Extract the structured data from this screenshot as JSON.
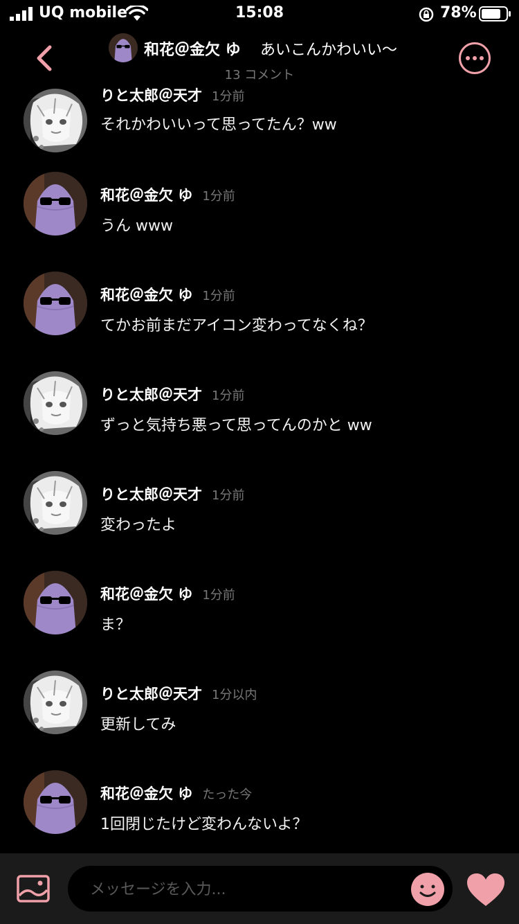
{
  "status_bar": {
    "carrier": "UQ mobile",
    "time": "15:08",
    "battery": "78%"
  },
  "header": {
    "user": "和花＠金欠 ゆ",
    "topic": "あいこんかわいい〜",
    "comment_count": "13 コメント"
  },
  "messages": [
    {
      "user": "りと太郎＠天才",
      "time": "1分前",
      "text": "それかわいいって思ってたん？ww",
      "avatar": "anime-girl"
    },
    {
      "user": "和花＠金欠 ゆ",
      "time": "1分前",
      "text": "うん www",
      "avatar": "purple-ghost"
    },
    {
      "user": "和花＠金欠 ゆ",
      "time": "1分前",
      "text": "てかお前まだアイコン変わってなくね？",
      "avatar": "purple-ghost"
    },
    {
      "user": "りと太郎＠天才",
      "time": "1分前",
      "text": "ずっと気持ち悪って思ってんのかと ww",
      "avatar": "anime-girl"
    },
    {
      "user": "りと太郎＠天才",
      "time": "1分前",
      "text": "変わったよ",
      "avatar": "anime-girl"
    },
    {
      "user": "和花＠金欠 ゆ",
      "time": "1分前",
      "text": "ま？",
      "avatar": "purple-ghost"
    },
    {
      "user": "りと太郎＠天才",
      "time": "1分以内",
      "text": "更新してみ",
      "avatar": "anime-girl"
    },
    {
      "user": "和花＠金欠 ゆ",
      "time": "たった今",
      "text": "1回閉じたけど変わんないよ？",
      "avatar": "purple-ghost"
    }
  ],
  "composer": {
    "placeholder": "メッセージを入力..."
  },
  "colors": {
    "accent": "#f0a0a8",
    "background": "#000000",
    "bar": "#1b1b1b",
    "muted": "#777777"
  },
  "icons": [
    "signal-icon",
    "wifi-icon",
    "rotation-lock-icon",
    "battery-icon",
    "back-icon",
    "more-icon",
    "image-icon",
    "smile-icon",
    "heart-icon"
  ]
}
